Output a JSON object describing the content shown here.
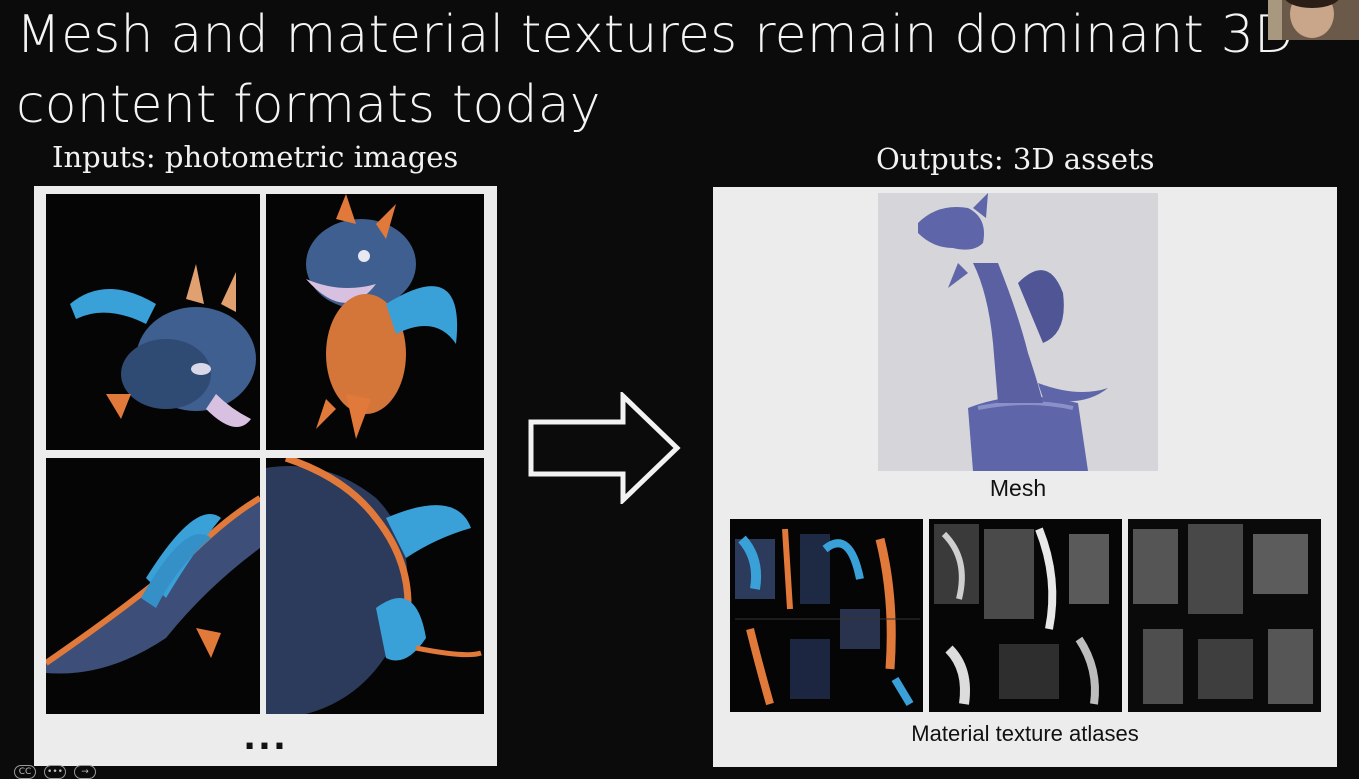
{
  "slide": {
    "title": "Mesh and material textures remain dominant 3D content formats today"
  },
  "inputs": {
    "label": "Inputs: photometric images",
    "ellipsis": "..."
  },
  "outputs": {
    "label": "Outputs: 3D assets",
    "mesh_caption": "Mesh",
    "atlas_caption": "Material texture atlases"
  },
  "colors": {
    "background": "#0b0b0b",
    "panel": "#ececec",
    "dragon_blue": "#3e5f8f",
    "dragon_orange": "#e0793a",
    "wing_blue": "#3aa0d8",
    "mesh_purple": "#5e65a8"
  },
  "player": {
    "cc_label": "CC",
    "more_icon": "more-icon",
    "forward_icon": "arrow-right-circle-icon"
  }
}
